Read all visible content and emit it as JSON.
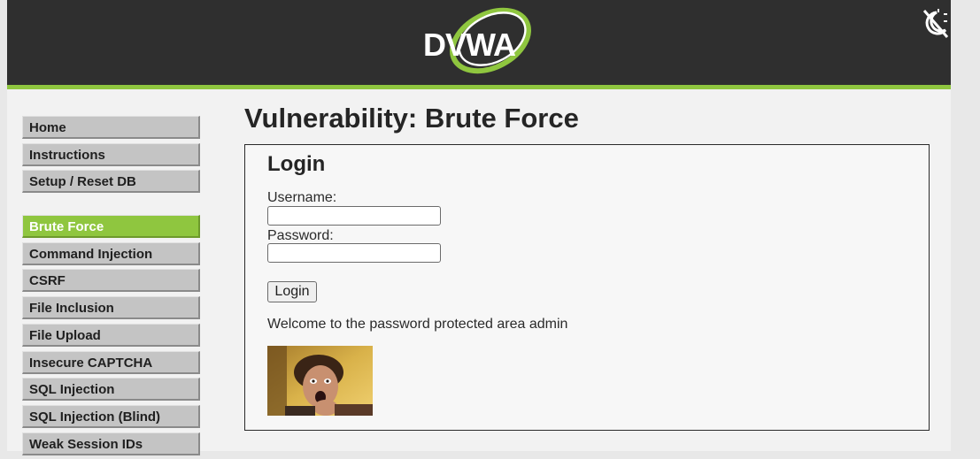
{
  "header": {
    "logo_text": "DVWA",
    "theme_toggle_icon": "theme-toggle-icon",
    "colors": {
      "header_bg": "#2f2f2f",
      "accent": "#8fc63f"
    }
  },
  "sidebar": {
    "groups": [
      {
        "items": [
          {
            "label": "Home"
          },
          {
            "label": "Instructions"
          },
          {
            "label": "Setup / Reset DB"
          }
        ]
      },
      {
        "items": [
          {
            "label": "Brute Force",
            "active": true
          },
          {
            "label": "Command Injection"
          },
          {
            "label": "CSRF"
          },
          {
            "label": "File Inclusion"
          },
          {
            "label": "File Upload"
          },
          {
            "label": "Insecure CAPTCHA"
          },
          {
            "label": "SQL Injection"
          },
          {
            "label": "SQL Injection (Blind)"
          },
          {
            "label": "Weak Session IDs"
          }
        ]
      }
    ]
  },
  "main": {
    "title": "Vulnerability: Brute Force",
    "form": {
      "heading": "Login",
      "username_label": "Username:",
      "username_value": "",
      "password_label": "Password:",
      "password_value": "",
      "submit_label": "Login"
    },
    "message": "Welcome to the password protected area admin",
    "user_image": "user-avatar-photo"
  }
}
